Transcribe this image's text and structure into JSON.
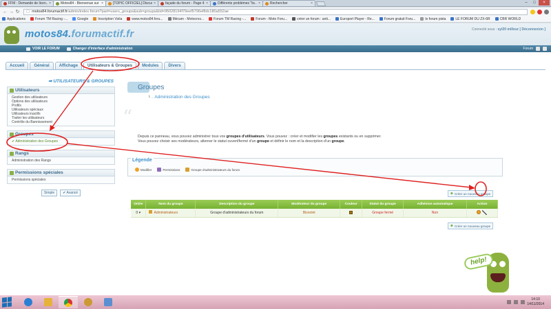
{
  "browser": {
    "tabs": [
      {
        "label": "FFM : Demande de licen...",
        "active": false
      },
      {
        "label": "Motos84 - Bienvenue sur ...",
        "active": true
      },
      {
        "label": "[TOPIC OFFICIEL] Discuss...",
        "active": false
      },
      {
        "label": "façade du forum - Page 4...",
        "active": false
      },
      {
        "label": "Différents problèmes \"lis...",
        "active": false
      },
      {
        "label": "Rechercher",
        "active": false
      }
    ],
    "url_host": "motos84.forumactif.fr",
    "url_path": "/admin/index.forum?part=users_groups&sub=groups&tid=95028194f79eef5796ef8dc180a552ae",
    "bookmarks": [
      "Applications",
      "Forum TM Racing -...",
      "Google",
      "Inscription Voila",
      "www.motos84.foru...",
      "Mécam - Motocros...",
      "Forum TM Racing -...",
      "Forum - Moto Foru...",
      "créer un forum : anti...",
      "Europort Player - Re...",
      "Forum gratuit Foru...",
      "le forum pista",
      "LE FORUM DU ZX-6R",
      "CBR WORLD"
    ]
  },
  "site": {
    "title_main": "motos84.",
    "title_domain": "forumactif.fr",
    "connected_prefix": "Connecté sous :",
    "connected_user": "syl20 millour",
    "connected_logout": "[ Déconnexion ]"
  },
  "topbar": {
    "view_forum": "VOIR LE FORUM",
    "change_interface": "Changer d'interface d'administration",
    "right_label": "Forum"
  },
  "admin_tabs": [
    "Accueil",
    "Général",
    "Affichage",
    "Utilisateurs & Groupes",
    "Modules",
    "Divers"
  ],
  "sidebar": {
    "section_title": "UTILISATEURS & GROUPES",
    "utilisateurs": {
      "title": "Utilisateurs",
      "links": [
        "Gestion des utilisateurs",
        "Options des utilisateurs",
        "Profils",
        "Utilisateurs spéciaux",
        "Utilisateurs inactifs",
        "Traiter les utilisateurs",
        "Contrôle du Bannissement"
      ]
    },
    "groupes": {
      "title": "Groupes",
      "links": [
        "Administration des Groupes"
      ]
    },
    "rangs": {
      "title": "Rangs",
      "links": [
        "Administration des Rangs"
      ]
    },
    "permissions": {
      "title": "Permissions spéciales",
      "links": [
        "Permissions spéciales"
      ]
    },
    "btn_simple": "Simple",
    "btn_avance": "Avancé"
  },
  "main": {
    "title": "Groupes",
    "subtitle": "Administration des Groupes",
    "intro_1a": "Depuis ce panneau, vous pouvez administrer tous vos ",
    "intro_1b": "groupes d'utilisateurs",
    "intro_1c": ". Vous pouvez : créer et modifier les ",
    "intro_1d": "groupes",
    "intro_1e": " existants ou en supprimer.",
    "intro_2a": "Vous pouvez choisir ses modérateurs, alterner le statut ouvert/fermé d'un ",
    "intro_2b": "groupe",
    "intro_2c": " et définir le nom et la description d'un ",
    "intro_2d": "groupe",
    "intro_2e": ".",
    "legend_title": "Légende",
    "legend": [
      "Modifier",
      "Permissions",
      "Groupe d'administrateurs du forum"
    ],
    "create_label": "Créer un nouveau groupe",
    "table": {
      "headers": [
        "Ordre",
        "Nom du groupe",
        "Description du groupe",
        "Modérateur du groupe",
        "Couleur",
        "Statut du groupe",
        "Adhésion automatique",
        "Action"
      ],
      "row": {
        "order": "0",
        "name": "Administrateurs",
        "description": "Groupe d'administrateurs du forum",
        "moderator": "Bisnolet",
        "status": "Groupe fermé",
        "auto": "Non"
      }
    },
    "help": "help!"
  },
  "taskbar": {
    "time": "14:10",
    "date": "14/11/2014"
  },
  "colors": {
    "accent": "#3c8fc9",
    "table_green": "#78b234",
    "annotation_red": "#e02020"
  }
}
